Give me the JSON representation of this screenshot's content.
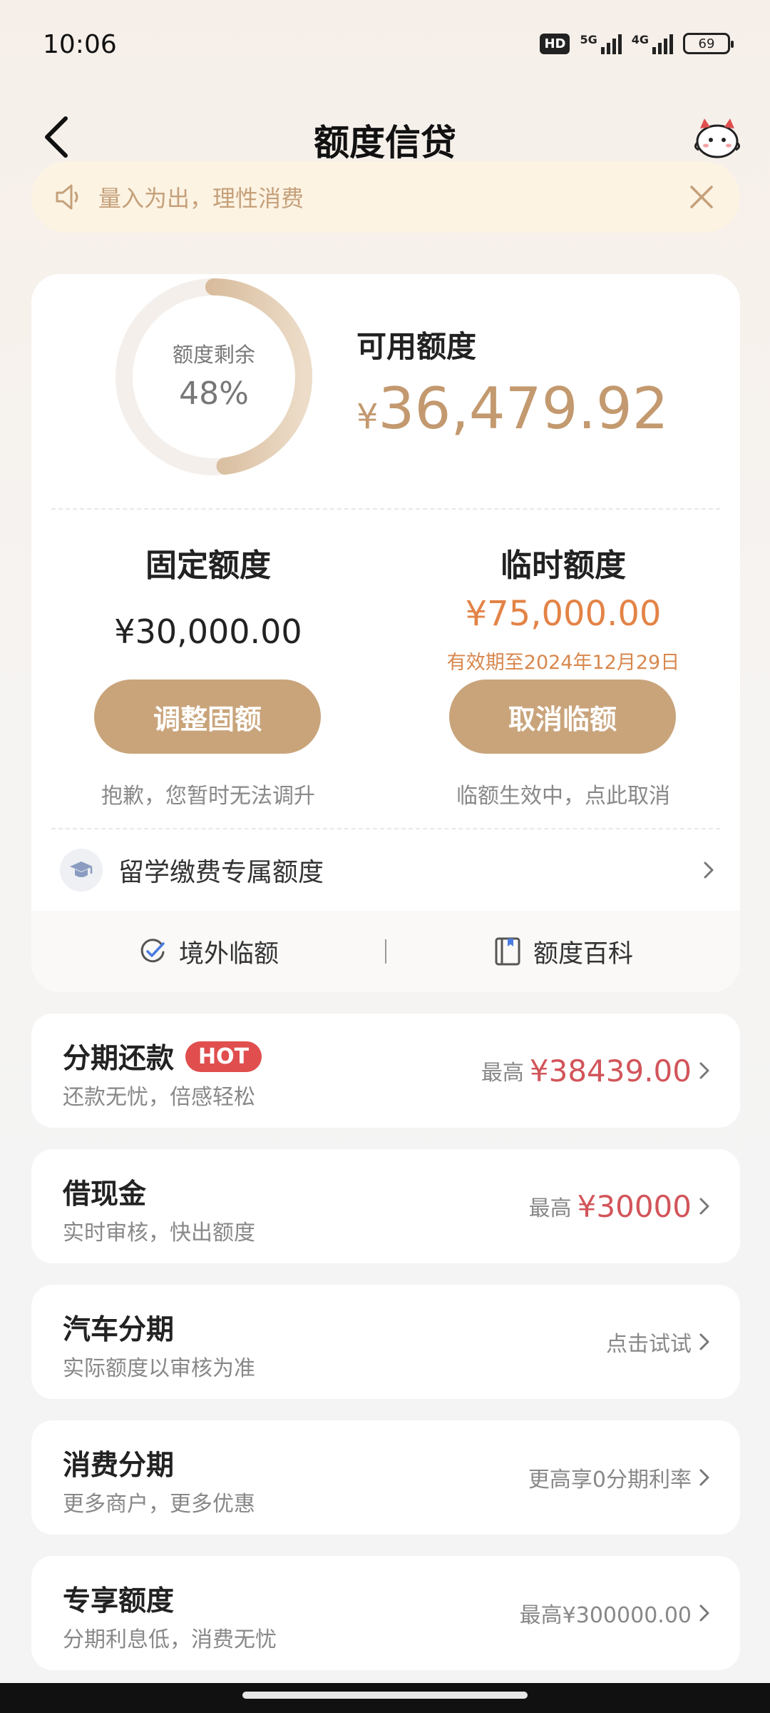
{
  "status_bar": {
    "time": "10:06",
    "hd": "HD",
    "sig1": "5G",
    "sig2": "4G",
    "battery": "69"
  },
  "header": {
    "title": "额度信贷",
    "back_icon": "chevron-left-icon",
    "mascot_icon": "mascot-avatar-icon"
  },
  "notice": {
    "text": "量入为出，理性消费",
    "icon": "speaker-icon",
    "close_icon": "close-icon"
  },
  "summary": {
    "ring_label": "额度剩余",
    "ring_value": "48%",
    "ring_fraction": 0.48,
    "available_label": "可用额度",
    "available_currency": "¥",
    "available_amount": "36,479.92"
  },
  "fixed": {
    "title": "固定额度",
    "amount": "¥30,000.00",
    "button": "调整固额",
    "note": "抱歉，您暂时无法调升"
  },
  "temporary": {
    "title": "临时额度",
    "amount": "¥75,000.00",
    "validity": "有效期至2024年12月29日",
    "button": "取消临额",
    "note": "临额生效中，点此取消"
  },
  "study_row": {
    "label": "留学缴费专属额度",
    "icon": "graduation-cap-icon"
  },
  "footer_links": [
    {
      "label": "境外临额",
      "icon": "refresh-check-icon"
    },
    {
      "label": "额度百科",
      "icon": "book-icon"
    }
  ],
  "list": [
    {
      "title": "分期还款",
      "badge": "HOT",
      "subtitle": "还款无忧，倍感轻松",
      "prefix": "最高",
      "value": "¥38439.00",
      "plain": ""
    },
    {
      "title": "借现金",
      "badge": "",
      "subtitle": "实时审核，快出额度",
      "prefix": "最高",
      "value": "¥30000",
      "plain": ""
    },
    {
      "title": "汽车分期",
      "badge": "",
      "subtitle": "实际额度以审核为准",
      "prefix": "",
      "value": "",
      "plain": "点击试试"
    },
    {
      "title": "消费分期",
      "badge": "",
      "subtitle": "更多商户，更多优惠",
      "prefix": "",
      "value": "",
      "plain": "更高享0分期利率"
    },
    {
      "title": "专享额度",
      "badge": "",
      "subtitle": "分期利息低，消费无忧",
      "prefix": "",
      "value": "",
      "plain": "最高¥300000.00"
    }
  ],
  "colors": {
    "accent": "#c9a47b",
    "amount_gold": "#c3996f",
    "temp_orange": "#e38346",
    "value_red": "#d2555a",
    "hot_red": "#e04e4e"
  }
}
